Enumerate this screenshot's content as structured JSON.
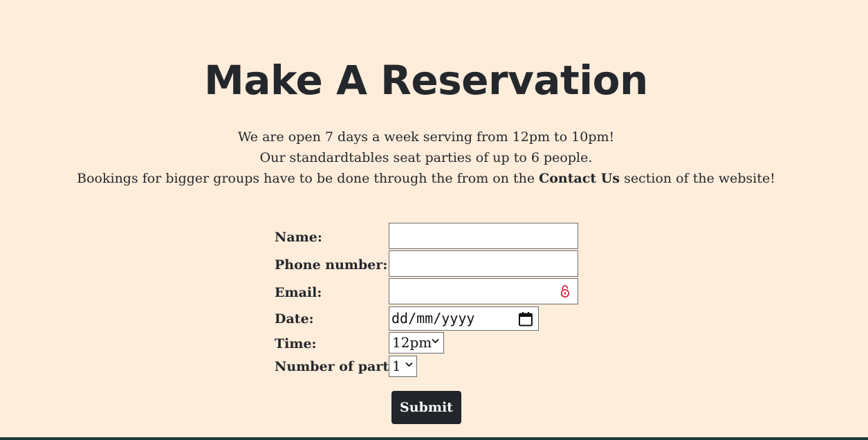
{
  "page": {
    "title": "Make A Reservation",
    "intro": {
      "line1": "We are open 7 days a week serving from 12pm to 10pm!",
      "line2": "Our standardtables seat parties of up to 6 people.",
      "line3_before": "Bookings for bigger groups have to be done through the from on the ",
      "line3_bold": "Contact Us",
      "line3_after": " section of the website!"
    }
  },
  "form": {
    "name_label": "Name:",
    "name_value": "",
    "phone_label": "Phone number:",
    "phone_value": "",
    "email_label": "Email:",
    "email_value": "",
    "date_label": "Date:",
    "date_placeholder": "dd/mm/yyyy",
    "time_label": "Time:",
    "time_selected": "12pm",
    "party_label": "Number of party:",
    "party_selected": "1",
    "submit_label": "Submit"
  },
  "icons": {
    "email_field_icon": "lock-icon",
    "date_field_icon": "calendar-icon",
    "select_icon": "chevron-down-icon"
  },
  "colors": {
    "background": "#ffeddb",
    "text": "#24272b",
    "button": "#22252a",
    "lock_icon": "#e0102e",
    "footer": "#1f3a3c"
  }
}
